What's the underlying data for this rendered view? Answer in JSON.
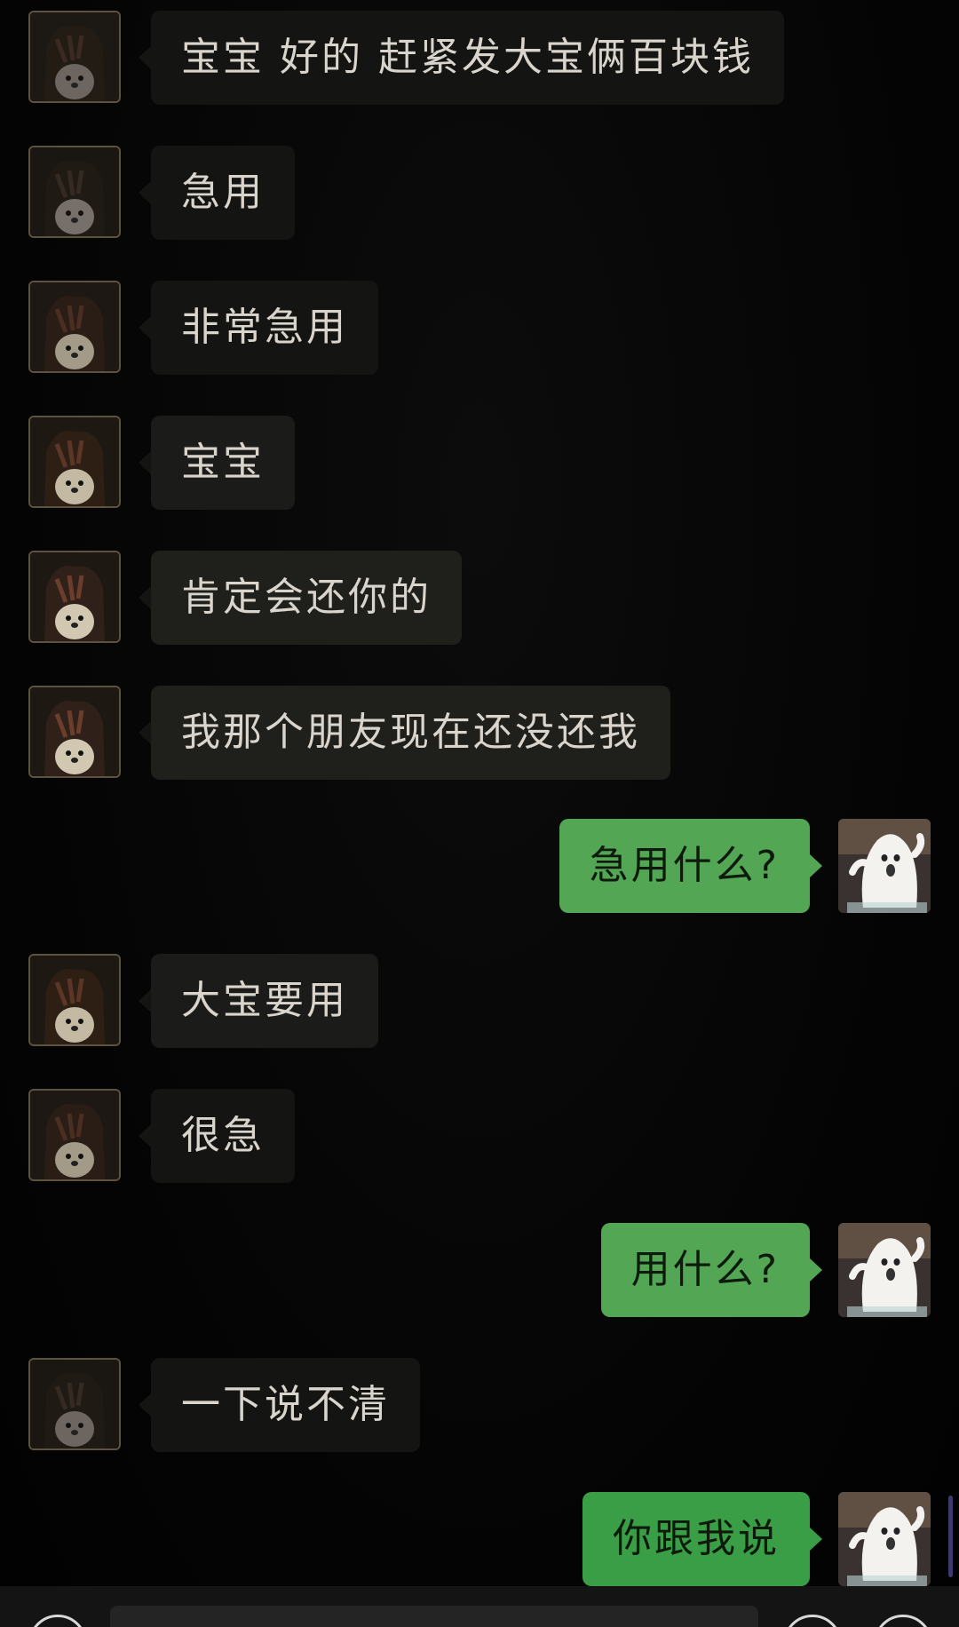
{
  "colors": {
    "background": "#050505",
    "incoming_bubble": "#141412",
    "incoming_text": "#d9d4cc",
    "outgoing_bubble": "#52a654",
    "outgoing_text": "#0d1a0c"
  },
  "messages": [
    {
      "side": "left",
      "text": "宝宝 好的 赶紧发大宝俩百块钱",
      "avatar": "hedgehog-avatar"
    },
    {
      "side": "left",
      "text": "急用",
      "avatar": "hedgehog-avatar"
    },
    {
      "side": "left",
      "text": "非常急用",
      "avatar": "hedgehog-avatar"
    },
    {
      "side": "left",
      "text": "宝宝",
      "avatar": "hedgehog-avatar"
    },
    {
      "side": "left",
      "text": "肯定会还你的",
      "avatar": "hedgehog-avatar"
    },
    {
      "side": "left",
      "text": "我那个朋友现在还没还我",
      "avatar": "hedgehog-avatar"
    },
    {
      "side": "right",
      "text": "急用什么?",
      "avatar": "ghost-avatar"
    },
    {
      "side": "left",
      "text": "大宝要用",
      "avatar": "hedgehog-avatar"
    },
    {
      "side": "left",
      "text": "很急",
      "avatar": "hedgehog-avatar"
    },
    {
      "side": "right",
      "text": "用什么?",
      "avatar": "ghost-avatar"
    },
    {
      "side": "left",
      "text": "一下说不清",
      "avatar": "hedgehog-avatar"
    },
    {
      "side": "right",
      "text": "你跟我说",
      "avatar": "ghost-avatar"
    }
  ],
  "input_bar": {
    "voice_icon": "voice-icon",
    "emoji_icon": "emoji-icon",
    "plus_icon": "plus-icon"
  }
}
